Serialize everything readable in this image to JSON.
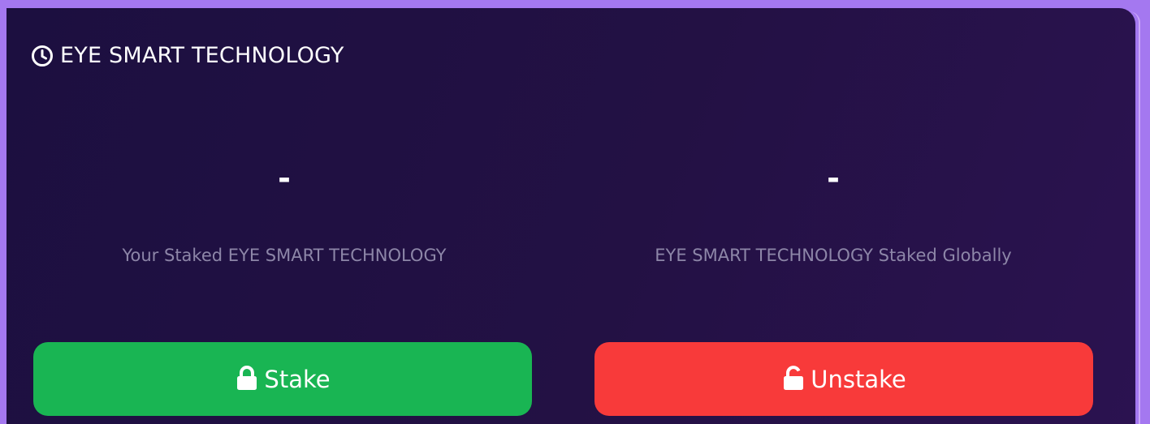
{
  "card": {
    "title": "EYE SMART TECHNOLOGY",
    "title_icon": "clock-icon"
  },
  "stats": {
    "your_staked": {
      "value": "-",
      "label": "Your Staked EYE SMART TECHNOLOGY"
    },
    "global_staked": {
      "value": "-",
      "label": "EYE SMART TECHNOLOGY Staked Globally"
    }
  },
  "actions": {
    "stake_label": "Stake",
    "stake_icon": "lock-icon",
    "stake_color": "#19b553",
    "unstake_label": "Unstake",
    "unstake_icon": "unlock-icon",
    "unstake_color": "#f83a3a"
  }
}
